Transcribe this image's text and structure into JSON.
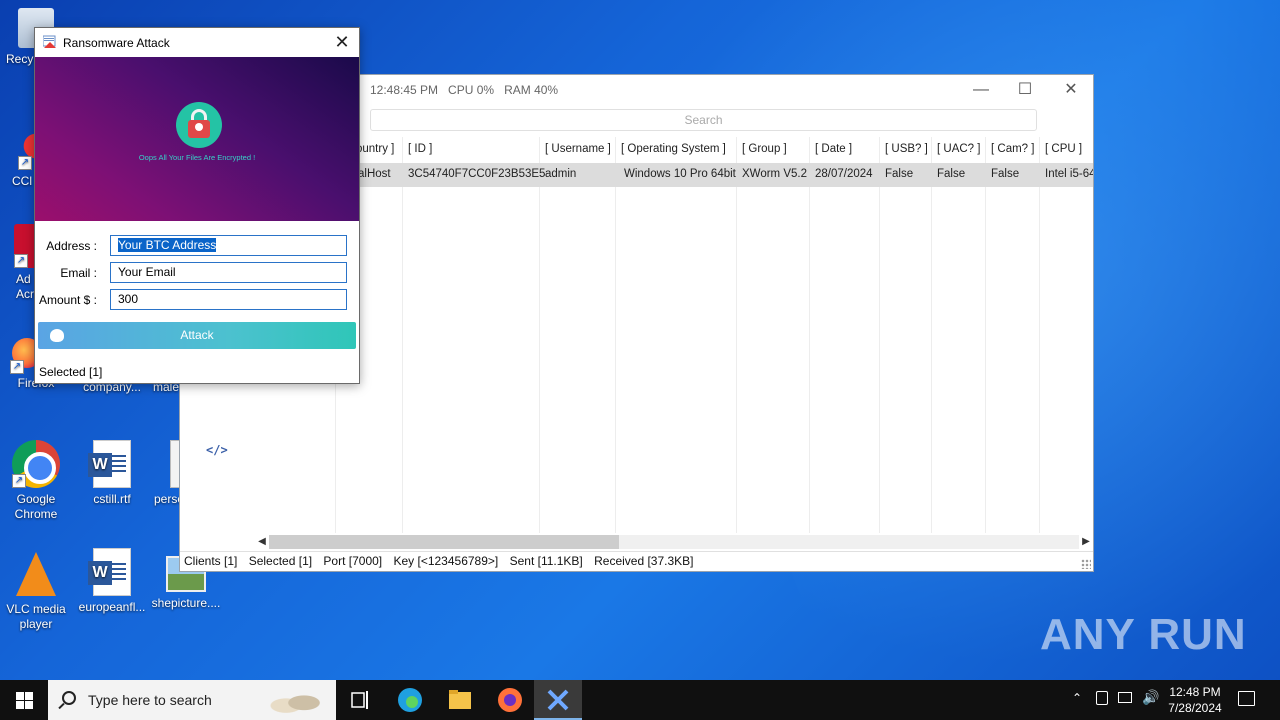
{
  "desktop": {
    "icons": [
      {
        "label": "Recy"
      },
      {
        "label": "CCl"
      },
      {
        "label": "Ad\nAcr"
      },
      {
        "label": "Firefox"
      },
      {
        "label": "company..."
      },
      {
        "label": "male"
      },
      {
        "label": "Google\nChrome"
      },
      {
        "label": "cstill.rtf"
      },
      {
        "label": "perso"
      },
      {
        "label": "VLC media\nplayer"
      },
      {
        "label": "europeanfl..."
      },
      {
        "label": "shepicture...."
      }
    ],
    "watermark": "ANY RUN"
  },
  "main_window": {
    "stats": "12:48:45 PM   CPU 0%   RAM 40%",
    "search_placeholder": "Search",
    "columns": [
      "ountry ]",
      "[ ID ]",
      "[ Username ]",
      "[ Operating System ]",
      "[ Group ]",
      "[ Date ]",
      "[ USB? ]",
      "[ UAC? ]",
      "[ Cam? ]",
      "[ CPU ]"
    ],
    "row": [
      "alHost",
      "3C54740F7CC0F23B53E5",
      "admin",
      "Windows 10 Pro 64bit",
      "XWorm V5.2",
      "28/07/2024",
      "False",
      "False",
      "False",
      "Intel  i5-64"
    ],
    "code_icon": "</>",
    "status": {
      "clients": "Clients [1]",
      "selected": "Selected [1]",
      "port": "Port [7000]",
      "key": "Key [<123456789>]",
      "sent": "Sent [11.1KB]",
      "received": "Received [37.3KB]"
    }
  },
  "dialog": {
    "title": "Ransomware Attack",
    "banner_text": "Oops All Your Files Are Encrypted !",
    "fields": {
      "address_label": "Address :",
      "address_value": "Your BTC Address",
      "email_label": "Email :",
      "email_value": "Your Email",
      "amount_label": "Amount $ :",
      "amount_value": "300"
    },
    "attack_label": "Attack",
    "status": "Selected [1]"
  },
  "taskbar": {
    "search_placeholder": "Type here to search",
    "time": "12:48 PM",
    "date": "7/28/2024"
  }
}
